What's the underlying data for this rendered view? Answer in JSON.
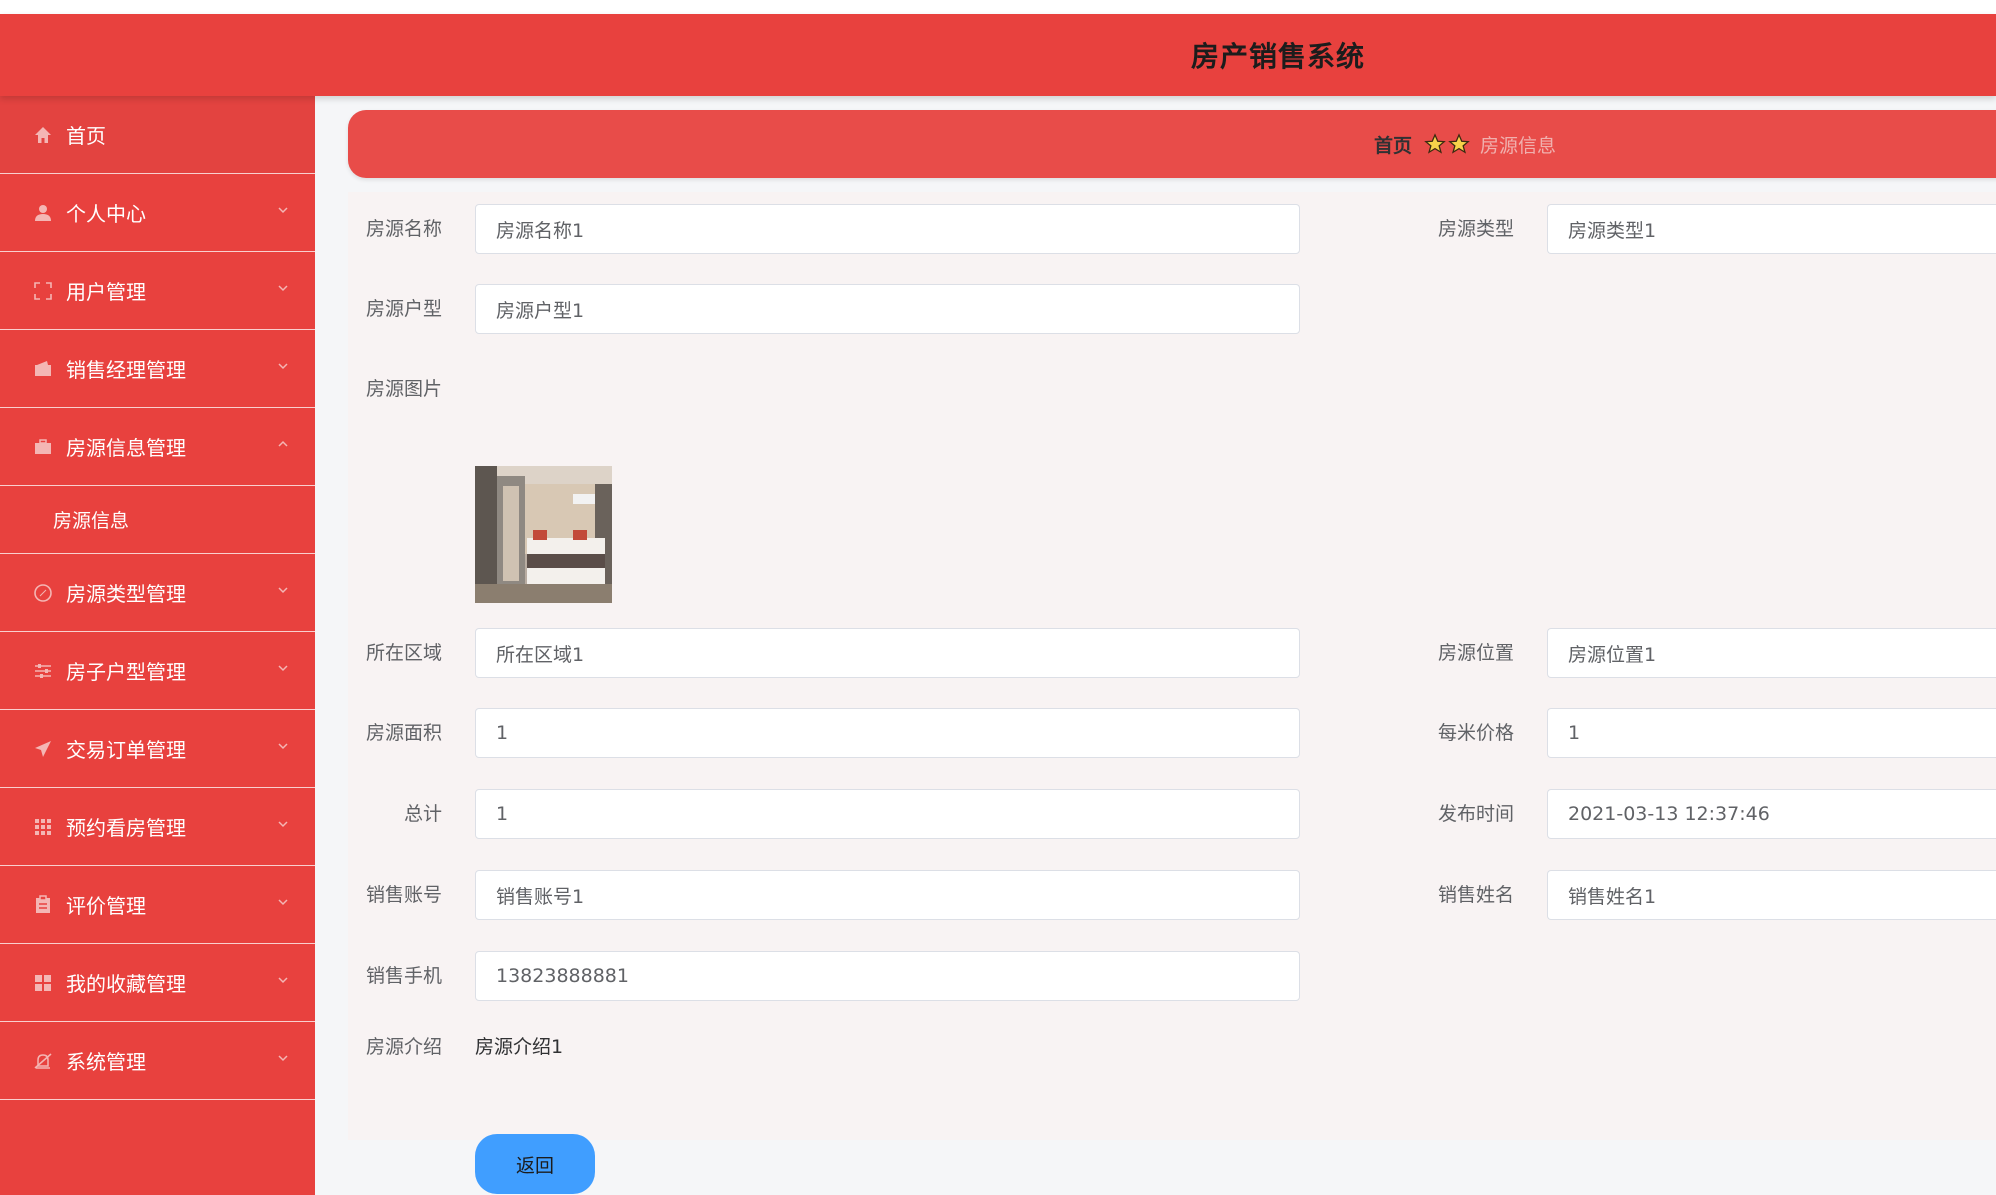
{
  "header": {
    "title": "房产销售系统"
  },
  "sidebar": {
    "home": {
      "label": "首页",
      "icon": "home-icon"
    },
    "items": [
      {
        "label": "个人中心",
        "icon": "user-icon"
      },
      {
        "label": "用户管理",
        "icon": "fullscreen-icon"
      },
      {
        "label": "销售经理管理",
        "icon": "wallet-icon"
      },
      {
        "label": "房源信息管理",
        "icon": "briefcase-icon",
        "expanded": true,
        "sub": [
          {
            "label": "房源信息"
          }
        ]
      },
      {
        "label": "房源类型管理",
        "icon": "compass-icon"
      },
      {
        "label": "房子户型管理",
        "icon": "sliders-icon"
      },
      {
        "label": "交易订单管理",
        "icon": "send-icon"
      },
      {
        "label": "预约看房管理",
        "icon": "grid-icon"
      },
      {
        "label": "评价管理",
        "icon": "clipboard-icon"
      },
      {
        "label": "我的收藏管理",
        "icon": "apps-icon"
      },
      {
        "label": "系统管理",
        "icon": "bell-off-icon"
      }
    ]
  },
  "breadcrumb": {
    "home": "首页",
    "current": "房源信息",
    "separator_icon": "star-icon"
  },
  "form": {
    "name_label": "房源名称",
    "name_value": "房源名称1",
    "type_label": "房源类型",
    "type_value": "房源类型1",
    "layout_label": "房源户型",
    "layout_value": "房源户型1",
    "image_label": "房源图片",
    "area_region_label": "所在区域",
    "area_region_value": "所在区域1",
    "location_label": "房源位置",
    "location_value": "房源位置1",
    "size_label": "房源面积",
    "size_value": "1",
    "unit_price_label": "每米价格",
    "unit_price_value": "1",
    "total_label": "总计",
    "total_value": "1",
    "publish_label": "发布时间",
    "publish_value": "2021-03-13 12:37:46",
    "sales_account_label": "销售账号",
    "sales_account_value": "销售账号1",
    "sales_name_label": "销售姓名",
    "sales_name_value": "销售姓名1",
    "sales_phone_label": "销售手机",
    "sales_phone_value": "13823888881",
    "intro_label": "房源介绍",
    "intro_value": "房源介绍1",
    "back_label": "返回"
  },
  "colors": {
    "primary": "#e8413e",
    "button": "#409eff"
  }
}
